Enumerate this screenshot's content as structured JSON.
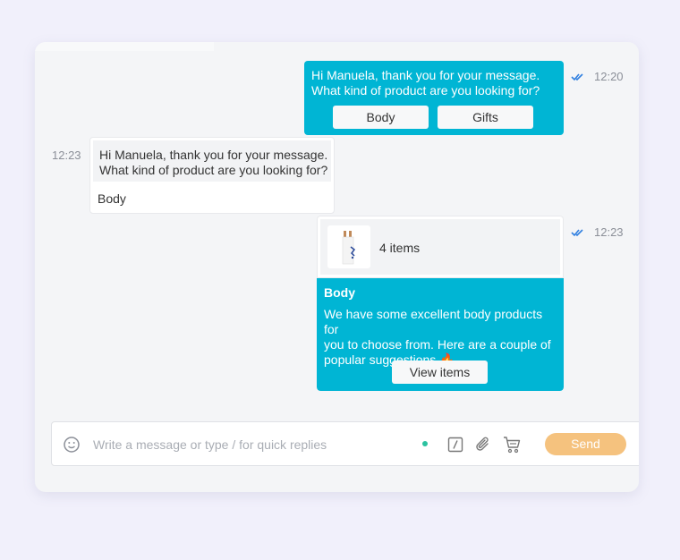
{
  "messages": [
    {
      "direction": "outgoing",
      "text_line1": "Hi Manuela, thank you for your message.",
      "text_line2": "What kind of product are you looking for?",
      "quick_replies": [
        "Body",
        "Gifts"
      ],
      "time": "12:20",
      "status_icon": "double-check-icon"
    },
    {
      "direction": "incoming",
      "quote_line1": "Hi Manuela, thank you for your message.",
      "quote_line2": "What kind of product are you looking for?",
      "reply": "Body",
      "time": "12:23"
    },
    {
      "direction": "outgoing",
      "items_count": "4 items",
      "title": "Body",
      "desc_line1": "We have some excellent body products for",
      "desc_line2": "you to choose from. Here are a couple of",
      "desc_line3": "popular suggestions 🔥",
      "button": "View items",
      "time": "12:23",
      "status_icon": "double-check-icon"
    }
  ],
  "composer": {
    "placeholder": "Write a message or type / for quick replies",
    "send_label": "Send"
  },
  "colors": {
    "accent": "#00b5d4",
    "send": "#f5c27e",
    "tick": "#2f7fe0",
    "online_dot": "#2bc2a0"
  }
}
